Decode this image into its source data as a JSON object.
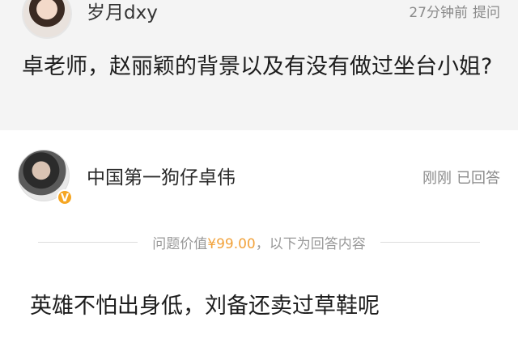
{
  "question": {
    "asker_name": "岁月dxy",
    "time": "27分钟前",
    "action": "提问",
    "text": "卓老师，赵丽颖的背景以及有没有做过坐台小姐?"
  },
  "answer": {
    "answerer_name": "中国第一狗仔卓伟",
    "badge": "V",
    "time": "刚刚",
    "status": "已回答",
    "price_prefix": "问题价值",
    "price": "¥99.00",
    "price_suffix": "，以下为回答内容",
    "text": "英雄不怕出身低，刘备还卖过草鞋呢"
  },
  "colors": {
    "price_accent": "#f2a23a",
    "badge": "#f5a623",
    "question_bg": "#f4f4f4"
  }
}
